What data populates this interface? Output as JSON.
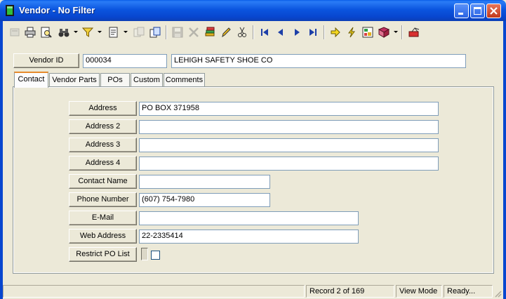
{
  "window": {
    "title": "Vendor - No Filter"
  },
  "toolbar": {
    "icons": [
      "new-icon",
      "print-icon",
      "preview-icon",
      "binoculars-icon",
      "filter-icon",
      "report-icon",
      "copy-icon",
      "duplicate-icon",
      "save-icon",
      "delete-icon",
      "stack-icon",
      "pencil-icon",
      "scissors-icon",
      "first-record-icon",
      "prev-record-icon",
      "next-record-icon",
      "last-record-icon",
      "arrow-right-icon",
      "lightning-icon",
      "lookup-icon",
      "book-icon",
      "exit-icon"
    ]
  },
  "header": {
    "vendor_id_label": "Vendor ID",
    "vendor_id_value": "000034",
    "vendor_name_value": "LEHIGH SAFETY SHOE CO"
  },
  "tabs": [
    {
      "label": "Contact",
      "active": true
    },
    {
      "label": "Vendor Parts",
      "active": false
    },
    {
      "label": "POs",
      "active": false
    },
    {
      "label": "Custom",
      "active": false
    },
    {
      "label": "Comments",
      "active": false
    }
  ],
  "contact": {
    "address_label": "Address",
    "address_value": "PO BOX 371958",
    "address2_label": "Address 2",
    "address2_value": "",
    "address3_label": "Address 3",
    "address3_value": "",
    "address4_label": "Address 4",
    "address4_value": "",
    "contact_name_label": "Contact Name",
    "contact_name_value": "",
    "phone_label": "Phone Number",
    "phone_value": "(607) 754-7980",
    "email_label": "E-Mail",
    "email_value": "",
    "web_label": "Web Address",
    "web_value": "22-2335414",
    "restrict_label": "Restrict PO List",
    "restrict_checked": false
  },
  "status": {
    "record": "Record 2 of 169",
    "mode": "View Mode",
    "state": "Ready..."
  },
  "colors": {
    "titlebar": "#0846cf",
    "face": "#ece9d8",
    "field_border": "#7f9db9",
    "tab_highlight": "#e68b2c"
  }
}
